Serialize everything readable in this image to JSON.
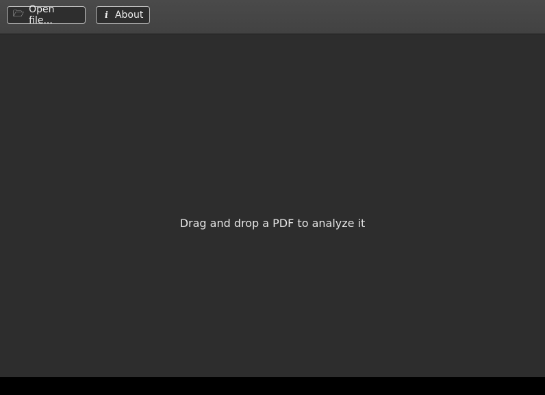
{
  "toolbar": {
    "open_label": "Open file...",
    "open_icon": "folder-open-icon",
    "about_label": "About",
    "about_icon": "info-icon"
  },
  "main": {
    "message": "Drag and drop a PDF to analyze it"
  }
}
